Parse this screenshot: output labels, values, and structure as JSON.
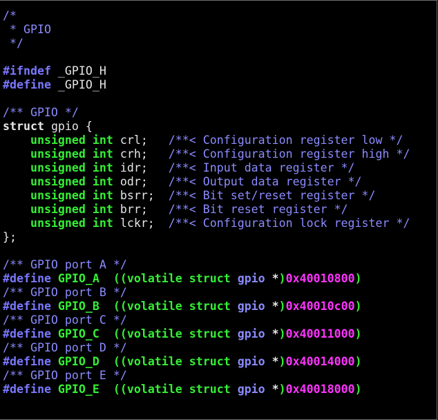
{
  "editor": {
    "background": "#000000",
    "colors": {
      "comment": "#8b8bff",
      "preprocessor": "#7a78ff",
      "keyword": "#e6e6e6",
      "type": "#35ef35",
      "number": "#ff33ff",
      "plain": "#e6e6e6"
    },
    "lines": [
      [
        {
          "t": "comment",
          "s": "/*"
        }
      ],
      [
        {
          "t": "comment",
          "s": " * GPIO"
        }
      ],
      [
        {
          "t": "comment",
          "s": " */"
        }
      ],
      [],
      [
        {
          "t": "preproc",
          "s": "#ifndef"
        },
        {
          "t": "plain",
          "s": " _GPIO_H"
        }
      ],
      [
        {
          "t": "preproc",
          "s": "#define"
        },
        {
          "t": "plain",
          "s": " _GPIO_H"
        }
      ],
      [],
      [
        {
          "t": "comment",
          "s": "/** GPIO */"
        }
      ],
      [
        {
          "t": "keyword",
          "s": "struct"
        },
        {
          "t": "plain",
          "s": " gpio {"
        }
      ],
      [
        {
          "t": "plain",
          "s": "    "
        },
        {
          "t": "type",
          "s": "unsigned int"
        },
        {
          "t": "plain",
          "s": " crl;   "
        },
        {
          "t": "comment",
          "s": "/**< Configuration register low */"
        }
      ],
      [
        {
          "t": "plain",
          "s": "    "
        },
        {
          "t": "type",
          "s": "unsigned int"
        },
        {
          "t": "plain",
          "s": " crh;   "
        },
        {
          "t": "comment",
          "s": "/**< Configuration register high */"
        }
      ],
      [
        {
          "t": "plain",
          "s": "    "
        },
        {
          "t": "type",
          "s": "unsigned int"
        },
        {
          "t": "plain",
          "s": " idr;   "
        },
        {
          "t": "comment",
          "s": "/**< Input data register */"
        }
      ],
      [
        {
          "t": "plain",
          "s": "    "
        },
        {
          "t": "type",
          "s": "unsigned int"
        },
        {
          "t": "plain",
          "s": " odr;   "
        },
        {
          "t": "comment",
          "s": "/**< Output data register */"
        }
      ],
      [
        {
          "t": "plain",
          "s": "    "
        },
        {
          "t": "type",
          "s": "unsigned int"
        },
        {
          "t": "plain",
          "s": " bsrr;  "
        },
        {
          "t": "comment",
          "s": "/**< Bit set/reset register */"
        }
      ],
      [
        {
          "t": "plain",
          "s": "    "
        },
        {
          "t": "type",
          "s": "unsigned int"
        },
        {
          "t": "plain",
          "s": " brr;   "
        },
        {
          "t": "comment",
          "s": "/**< Bit reset register */"
        }
      ],
      [
        {
          "t": "plain",
          "s": "    "
        },
        {
          "t": "type",
          "s": "unsigned int"
        },
        {
          "t": "plain",
          "s": " lckr;  "
        },
        {
          "t": "comment",
          "s": "/**< Configuration lock register */"
        }
      ],
      [
        {
          "t": "plain",
          "s": "};"
        }
      ],
      [],
      [
        {
          "t": "comment",
          "s": "/** GPIO port A */"
        }
      ],
      [
        {
          "t": "preproc",
          "s": "#define"
        },
        {
          "t": "castpar",
          "s": " GPIO_A  (("
        },
        {
          "t": "castkw",
          "s": "volatile struct"
        },
        {
          "t": "plain",
          "s": " "
        },
        {
          "t": "casttype",
          "s": "gpio"
        },
        {
          "t": "caststar",
          "s": " *"
        },
        {
          "t": "castpar",
          "s": ")"
        },
        {
          "t": "number",
          "s": "0x40010800"
        },
        {
          "t": "castpar",
          "s": ")"
        }
      ],
      [
        {
          "t": "comment",
          "s": "/** GPIO port B */"
        }
      ],
      [
        {
          "t": "preproc",
          "s": "#define"
        },
        {
          "t": "castpar",
          "s": " GPIO_B  (("
        },
        {
          "t": "castkw",
          "s": "volatile struct"
        },
        {
          "t": "plain",
          "s": " "
        },
        {
          "t": "casttype",
          "s": "gpio"
        },
        {
          "t": "caststar",
          "s": " *"
        },
        {
          "t": "castpar",
          "s": ")"
        },
        {
          "t": "number",
          "s": "0x40010c00"
        },
        {
          "t": "castpar",
          "s": ")"
        }
      ],
      [
        {
          "t": "comment",
          "s": "/** GPIO port C */"
        }
      ],
      [
        {
          "t": "preproc",
          "s": "#define"
        },
        {
          "t": "castpar",
          "s": " GPIO_C  (("
        },
        {
          "t": "castkw",
          "s": "volatile struct"
        },
        {
          "t": "plain",
          "s": " "
        },
        {
          "t": "casttype",
          "s": "gpio"
        },
        {
          "t": "caststar",
          "s": " *"
        },
        {
          "t": "castpar",
          "s": ")"
        },
        {
          "t": "number",
          "s": "0x40011000"
        },
        {
          "t": "castpar",
          "s": ")"
        }
      ],
      [
        {
          "t": "comment",
          "s": "/** GPIO port D */"
        }
      ],
      [
        {
          "t": "preproc",
          "s": "#define"
        },
        {
          "t": "castpar",
          "s": " GPIO_D  (("
        },
        {
          "t": "castkw",
          "s": "volatile struct"
        },
        {
          "t": "plain",
          "s": " "
        },
        {
          "t": "casttype",
          "s": "gpio"
        },
        {
          "t": "caststar",
          "s": " *"
        },
        {
          "t": "castpar",
          "s": ")"
        },
        {
          "t": "number",
          "s": "0x40014000"
        },
        {
          "t": "castpar",
          "s": ")"
        }
      ],
      [
        {
          "t": "comment",
          "s": "/** GPIO port E */"
        }
      ],
      [
        {
          "t": "preproc",
          "s": "#define"
        },
        {
          "t": "castpar",
          "s": " GPIO_E  (("
        },
        {
          "t": "castkw",
          "s": "volatile struct"
        },
        {
          "t": "plain",
          "s": " "
        },
        {
          "t": "casttype",
          "s": "gpio"
        },
        {
          "t": "caststar",
          "s": " *"
        },
        {
          "t": "castpar",
          "s": ")"
        },
        {
          "t": "number",
          "s": "0x40018000"
        },
        {
          "t": "castpar",
          "s": ")"
        }
      ]
    ]
  }
}
